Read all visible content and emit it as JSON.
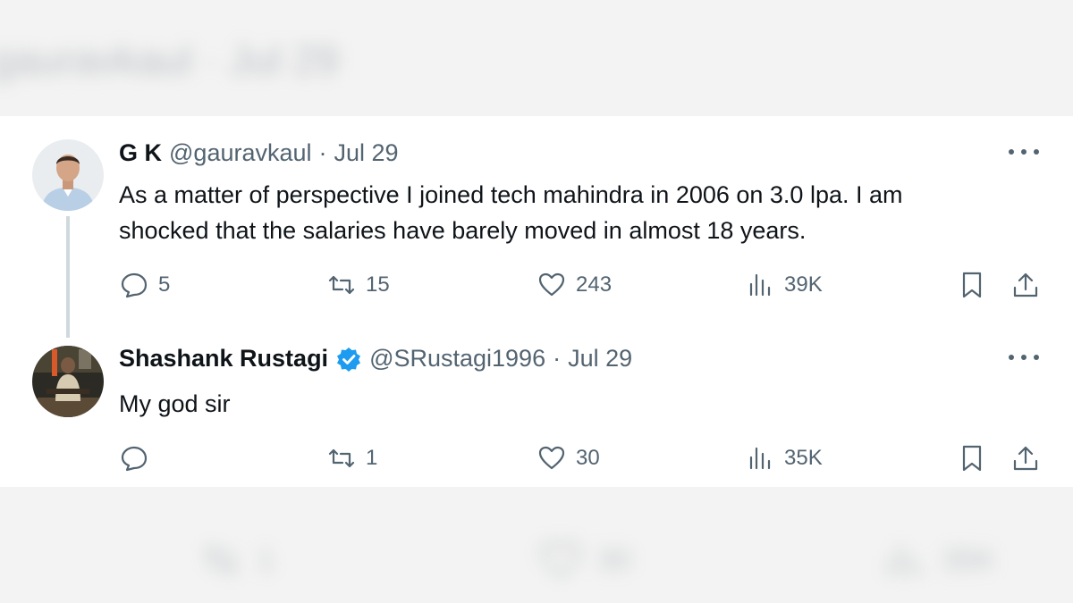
{
  "background": {
    "top_text": "gauravkaul · Jul 29",
    "bottom_actions": [
      {
        "icon": "retweet-icon",
        "count": "1"
      },
      {
        "icon": "heart-icon",
        "count": "30"
      },
      {
        "icon": "views-icon",
        "count": "35K"
      }
    ]
  },
  "tweets": [
    {
      "name": "G K",
      "handle": "@gauravkaul",
      "separator": "·",
      "date": "Jul 29",
      "text_line1": "As a matter of perspective I joined tech mahindra in 2006 on 3.0 lpa. I am",
      "text_line2": "shocked that the salaries have barely moved in almost 18 years.",
      "verified": false,
      "replies": "5",
      "reposts": "15",
      "likes": "243",
      "views": "39K"
    },
    {
      "name": "Shashank Rustagi",
      "handle": "@SRustagi1996",
      "separator": "·",
      "date": "Jul 29",
      "text_line1": "My god sir",
      "verified": true,
      "replies": "",
      "reposts": "1",
      "likes": "30",
      "views": "35K"
    }
  ],
  "colors": {
    "text_primary": "#0f1419",
    "text_secondary": "#536471",
    "verified_blue": "#1d9bf0",
    "thread_line": "#cfd9de"
  }
}
